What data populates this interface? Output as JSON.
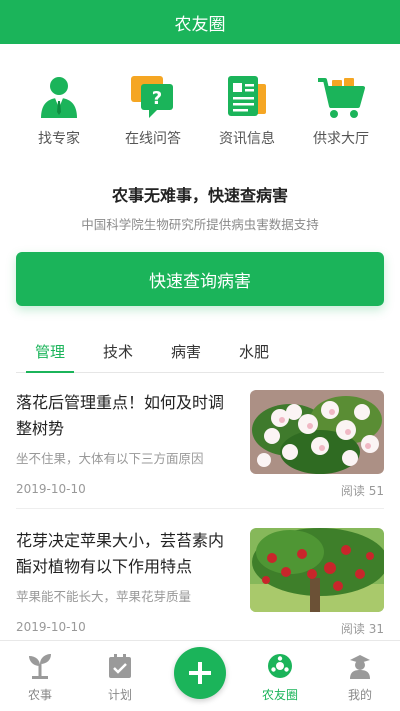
{
  "header": {
    "title": "农友圈"
  },
  "quick_actions": [
    {
      "label": "找专家",
      "icon": "expert-icon"
    },
    {
      "label": "在线问答",
      "icon": "qa-icon"
    },
    {
      "label": "资讯信息",
      "icon": "news-icon"
    },
    {
      "label": "供求大厅",
      "icon": "cart-icon"
    }
  ],
  "promo": {
    "title": "农事无难事，快速查病害",
    "subtitle": "中国科学院生物研究所提供病虫害数据支持",
    "button": "快速查询病害"
  },
  "tabs": [
    {
      "label": "管理",
      "active": true
    },
    {
      "label": "技术",
      "active": false
    },
    {
      "label": "病害",
      "active": false
    },
    {
      "label": "水肥",
      "active": false
    }
  ],
  "articles": [
    {
      "title": "落花后管理重点！如何及时调整树势",
      "summary": "坐不住果，大体有以下三方面原因",
      "date": "2019-10-10",
      "reads": "阅读 51"
    },
    {
      "title": "花芽决定苹果大小，芸苔素内酯对植物有以下作用特点",
      "summary": "苹果能不能长大，苹果花芽质量",
      "date": "2019-10-10",
      "reads": "阅读 31"
    }
  ],
  "bottom_nav": [
    {
      "label": "农事",
      "icon": "sprout-icon"
    },
    {
      "label": "计划",
      "icon": "calendar-icon"
    },
    {
      "label": "",
      "icon": "add-icon"
    },
    {
      "label": "农友圈",
      "icon": "community-icon",
      "active": true
    },
    {
      "label": "我的",
      "icon": "profile-icon"
    }
  ],
  "colors": {
    "brand": "#1bb45a",
    "accent_orange": "#f5a623"
  }
}
